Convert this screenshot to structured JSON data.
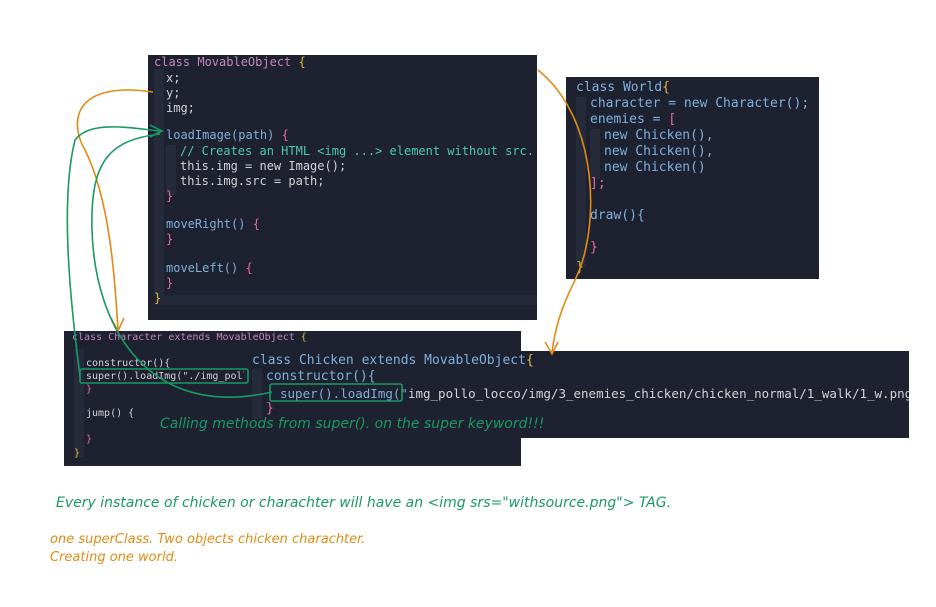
{
  "movable": {
    "l1": "class MovableObject ",
    "l1_brace": "{",
    "l2": "x;",
    "l3": "y;",
    "l4": "img;",
    "l5": "loadImage(path) ",
    "l5_brace": "{",
    "l6": "// Creates an HTML <img ...> element without src.",
    "l7": "this.img = new Image();",
    "l8": "this.img.src = path;",
    "l9": "}",
    "l10": "moveRight() ",
    "l10_brace": "{",
    "l11": "}",
    "l12": "moveLeft() ",
    "l12_brace": "{",
    "l13": "}",
    "l14": "}"
  },
  "world": {
    "l1": "class World",
    "l1_brace": "{",
    "l2": "character = new Character();",
    "l3": "enemies = ",
    "l3_bracket": "[",
    "l4": "new Chicken(),",
    "l5": "new Chicken(),",
    "l6": "new Chicken()",
    "l7": "];",
    "l8": "draw(){",
    "l9": "}",
    "l10": "}"
  },
  "character": {
    "l1": "class Character extends MovableObject ",
    "l1_brace": "{",
    "l2": "constructor(){",
    "l3": "super().loadImg(\"./img_poll",
    "l4": "}",
    "l5": "jump() {",
    "l6": "}",
    "l7": "}"
  },
  "chicken": {
    "l1": "class Chicken extends MovableObject",
    "l1_brace": "{",
    "l2": "constructor(){",
    "l3": "super().loadImg(\"",
    "l3_path": "img_pollo_locco/img/3_enemies_chicken/chicken_normal/1_walk/1_w.png\")",
    "l4": "}"
  },
  "notes": {
    "calling": "Calling methods from super(). on the super keyword!!!",
    "instance": "Every instance of chicken or charachter will have an <img srs=\"withsource.png\"> TAG.",
    "summary1": "one superClass. Two objects chicken charachter.",
    "summary2": "Creating one world."
  },
  "colors": {
    "panel_bg": "#1d2130",
    "annotation_green": "#1a9a62",
    "annotation_orange": "#e08b14"
  }
}
